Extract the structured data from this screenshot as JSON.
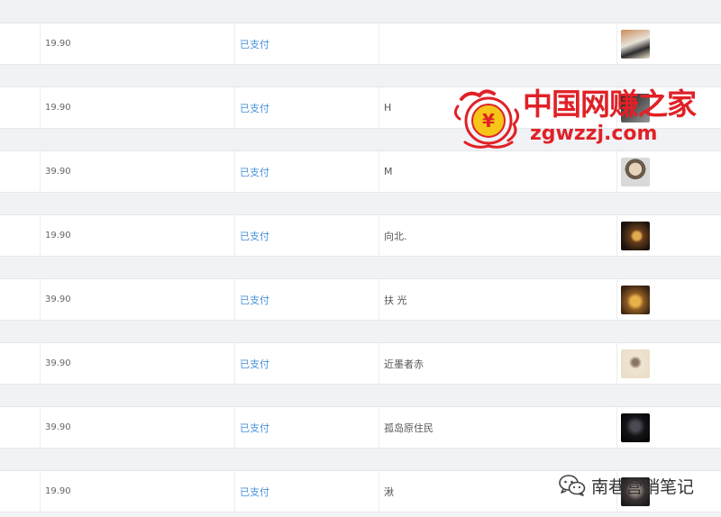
{
  "rows": [
    {
      "price": "19.90",
      "status": "已支付",
      "nickname": "",
      "avatar_icon": "avatar-photo-icon"
    },
    {
      "price": "19.90",
      "status": "已支付",
      "nickname": "H",
      "avatar_icon": "avatar-photo-icon"
    },
    {
      "price": "39.90",
      "status": "已支付",
      "nickname": "M",
      "avatar_icon": "avatar-photo-icon"
    },
    {
      "price": "19.90",
      "status": "已支付",
      "nickname": "向北.",
      "avatar_icon": "avatar-photo-icon"
    },
    {
      "price": "39.90",
      "status": "已支付",
      "nickname": "扶 光",
      "avatar_icon": "avatar-photo-icon"
    },
    {
      "price": "39.90",
      "status": "已支付",
      "nickname": "近墨者赤",
      "avatar_icon": "avatar-photo-icon"
    },
    {
      "price": "39.90",
      "status": "已支付",
      "nickname": "孤岛原住民",
      "avatar_icon": "avatar-photo-icon"
    },
    {
      "price": "19.90",
      "status": "已支付",
      "nickname": "湫",
      "avatar_icon": "avatar-photo-icon"
    }
  ],
  "watermark": {
    "title": "中国网赚之家",
    "url": "zgwzzj.com",
    "seal_glyph": "¥"
  },
  "wechat_watermark": {
    "text": "南巷营销笔记",
    "icon": "wechat-icon"
  },
  "colors": {
    "status_link": "#4a90d9",
    "watermark_red": "#e02127",
    "row_bg": "#ffffff",
    "gap_bg": "#f0f2f5"
  }
}
